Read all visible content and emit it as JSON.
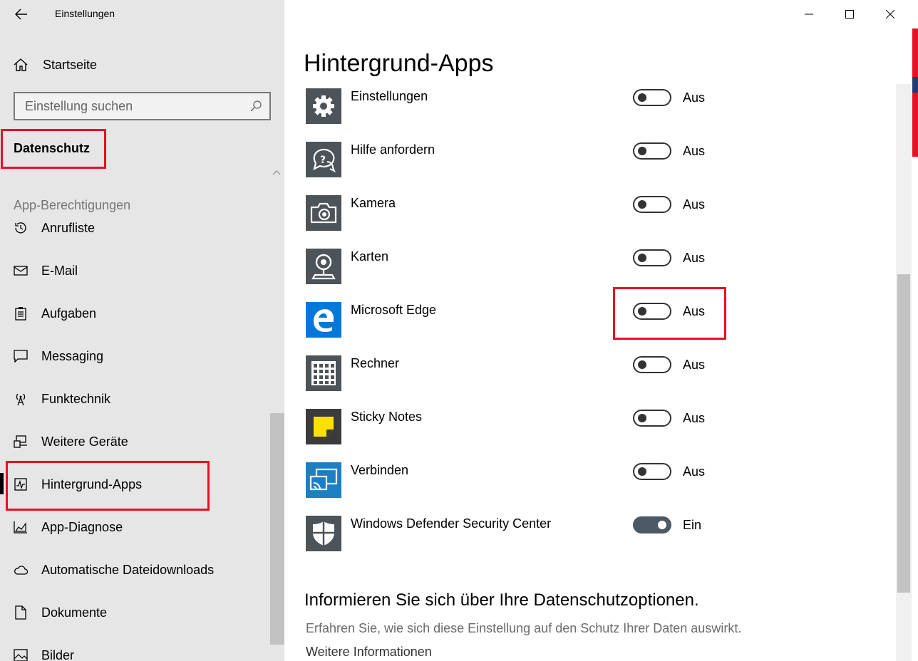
{
  "window": {
    "title": "Einstellungen"
  },
  "sidebar": {
    "home_label": "Startseite",
    "search_placeholder": "Einstellung suchen",
    "section_title": "Datenschutz",
    "permissions_heading": "App-Berechtigungen",
    "items": [
      {
        "label": "Anrufliste",
        "icon": "history-icon"
      },
      {
        "label": "E-Mail",
        "icon": "mail-icon"
      },
      {
        "label": "Aufgaben",
        "icon": "task-list-icon"
      },
      {
        "label": "Messaging",
        "icon": "chat-bubble-icon"
      },
      {
        "label": "Funktechnik",
        "icon": "radio-antenna-icon"
      },
      {
        "label": "Weitere Geräte",
        "icon": "devices-icon"
      },
      {
        "label": "Hintergrund-Apps",
        "icon": "activity-chart-icon",
        "active": true
      },
      {
        "label": "App-Diagnose",
        "icon": "area-chart-icon"
      },
      {
        "label": "Automatische Dateidownloads",
        "icon": "cloud-icon"
      },
      {
        "label": "Dokumente",
        "icon": "document-icon"
      },
      {
        "label": "Bilder",
        "icon": "picture-icon"
      }
    ]
  },
  "main": {
    "title": "Hintergrund-Apps",
    "apps": [
      {
        "name": "Einstellungen",
        "state": "Aus",
        "on": false,
        "icon": "gear-icon",
        "icon_bg": "#4c5359"
      },
      {
        "name": "Hilfe anfordern",
        "state": "Aus",
        "on": false,
        "icon": "help-chat-icon",
        "icon_bg": "#4c5359"
      },
      {
        "name": "Kamera",
        "state": "Aus",
        "on": false,
        "icon": "camera-icon",
        "icon_bg": "#4c5359"
      },
      {
        "name": "Karten",
        "state": "Aus",
        "on": false,
        "icon": "map-pin-icon",
        "icon_bg": "#4c5359"
      },
      {
        "name": "Microsoft Edge",
        "state": "Aus",
        "on": false,
        "icon": "edge-icon",
        "icon_bg": "#0078d7"
      },
      {
        "name": "Rechner",
        "state": "Aus",
        "on": false,
        "icon": "calculator-icon",
        "icon_bg": "#4c5359"
      },
      {
        "name": "Sticky Notes",
        "state": "Aus",
        "on": false,
        "icon": "sticky-note-icon",
        "icon_bg": "#3b3b3b"
      },
      {
        "name": "Verbinden",
        "state": "Aus",
        "on": false,
        "icon": "connect-icon",
        "icon_bg": "#1d7fc3"
      },
      {
        "name": "Windows Defender Security Center",
        "state": "Ein",
        "on": true,
        "icon": "shield-icon",
        "icon_bg": "#4c5359"
      }
    ],
    "privacy_heading": "Informieren Sie sich über Ihre Datenschutzoptionen.",
    "privacy_text": "Erfahren Sie, wie sich diese Einstellung auf den Schutz Ihrer Daten auswirkt.",
    "more_info_link": "Weitere Informationen"
  },
  "colors": {
    "highlight_red": "#e81123",
    "toggle_on": "#4d5a64",
    "sidebar_bg": "#e6e6e6"
  }
}
